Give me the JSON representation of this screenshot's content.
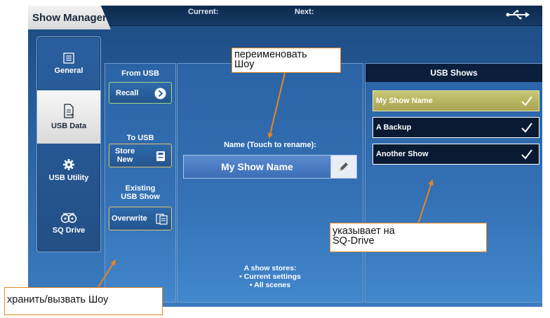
{
  "window": {
    "title": "Show Manager",
    "current_label": "Current:",
    "next_label": "Next:",
    "usb_icon": "usb-icon"
  },
  "sidebar": {
    "items": [
      {
        "label": "General",
        "icon": "list-icon",
        "active": false
      },
      {
        "label": "USB Data",
        "icon": "usb-file-icon",
        "active": true
      },
      {
        "label": "USB Utility",
        "icon": "gear-icon",
        "active": false
      },
      {
        "label": "SQ Drive",
        "icon": "drive-icon",
        "active": false
      }
    ]
  },
  "left_panel": {
    "from_usb_label": "From USB",
    "recall_label": "Recall",
    "to_usb_label": "To USB",
    "store_line1": "Store",
    "store_line2": "New",
    "existing_line1": "Existing",
    "existing_line2": "USB Show",
    "overwrite_label": "Overwrite"
  },
  "middle_panel": {
    "name_caption": "Name (Touch to rename):",
    "show_name": "My Show Name",
    "info_line1": "A show stores:",
    "info_line2": "• Current settings",
    "info_line3": "• All scenes"
  },
  "usb_shows": {
    "title": "USB Shows",
    "items": [
      {
        "name": "My Show Name",
        "selected": true
      },
      {
        "name": "A Backup",
        "selected": false
      },
      {
        "name": "Another Show",
        "selected": false
      }
    ]
  },
  "callouts": {
    "rename_line1": "переименовать",
    "rename_line2": "Шоу",
    "usb_line1": "указывает на",
    "usb_line2": "SQ-Drive",
    "store_recall": "хранить/вызвать Шоу"
  },
  "colors": {
    "accent": "#e8851f",
    "recall_border": "#9fd38a",
    "store_border": "#e1c56a",
    "selected_show": "#c8c672",
    "topbar": "#0d2a4c"
  }
}
